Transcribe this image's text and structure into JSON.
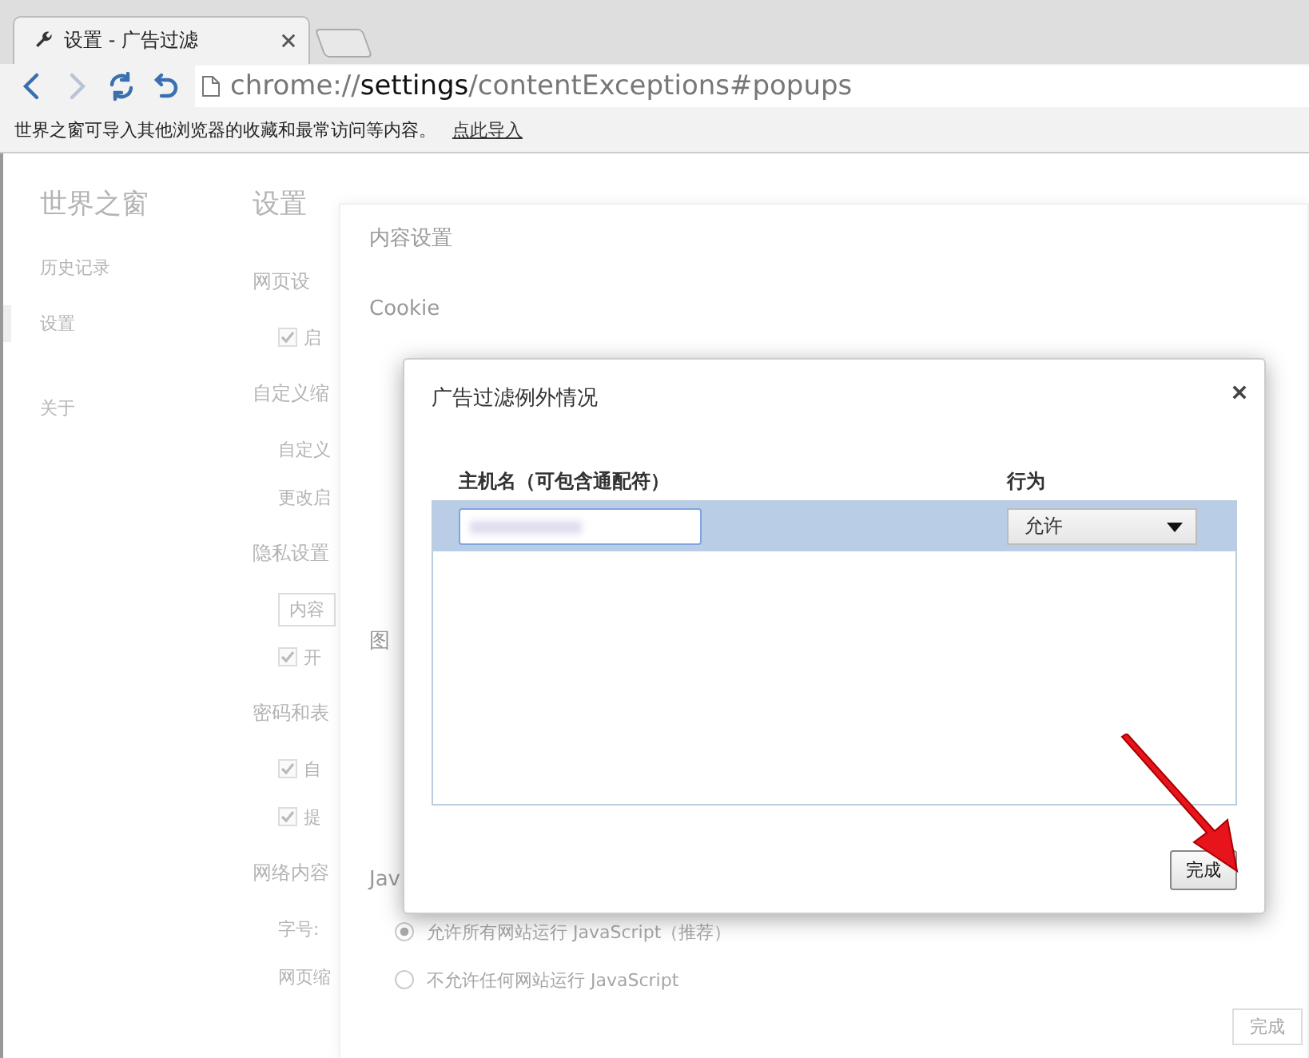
{
  "tabs": [
    {
      "title": "设置 - 广告过滤",
      "selected": true
    }
  ],
  "toolbar": {
    "buttons": [
      {
        "kind": "back",
        "disabled": false
      },
      {
        "kind": "forward",
        "disabled": true
      },
      {
        "kind": "reload",
        "disabled": false
      },
      {
        "kind": "undo",
        "disabled": false
      }
    ]
  },
  "address_bar": {
    "scheme": "chrome://",
    "host": "settings",
    "path": "/contentExceptions#popups"
  },
  "info_bar": {
    "text": "世界之窗可导入其他浏览器的收藏和最常访问等内容。",
    "link": "点此导入"
  },
  "background_page": {
    "sidebar": {
      "title": "世界之窗",
      "items": [
        {
          "label": "历史记录",
          "selected": false
        },
        {
          "label": "设置",
          "selected": true
        },
        {
          "label": "关于",
          "selected": false
        }
      ]
    },
    "settings": {
      "title": "设置",
      "rows": [
        {
          "kind": "heading",
          "text": "网页设"
        },
        {
          "kind": "checkbox",
          "text": "启",
          "checked": true
        },
        {
          "kind": "heading",
          "text": "自定义缩"
        },
        {
          "kind": "text",
          "text": "自定义"
        },
        {
          "kind": "text",
          "text": "更改启"
        },
        {
          "kind": "heading",
          "text": "隐私设置"
        },
        {
          "kind": "button",
          "text": "内容"
        },
        {
          "kind": "checkbox",
          "text": "开",
          "checked": true
        },
        {
          "kind": "heading",
          "text": "密码和表"
        },
        {
          "kind": "checkbox",
          "text": "自",
          "checked": true
        },
        {
          "kind": "checkbox",
          "text": "提",
          "checked": true
        },
        {
          "kind": "heading",
          "text": "网络内容"
        },
        {
          "kind": "text",
          "text": "字号:"
        },
        {
          "kind": "text",
          "text": "网页缩"
        }
      ]
    }
  },
  "content_settings": {
    "title": "内容设置",
    "sections": [
      {
        "heading": "Cookie"
      },
      {
        "heading": "图"
      },
      {
        "heading": "Jav",
        "options": [
          {
            "label": "允许所有网站运行 JavaScript（推荐）",
            "selected": true
          },
          {
            "label": "不允许任何网站运行 JavaScript",
            "selected": false
          }
        ]
      }
    ],
    "done_button": {
      "label": "完成",
      "disabled": true
    }
  },
  "dialog": {
    "title": "广告过滤例外情况",
    "columns": [
      "主机名（可包含通配符）",
      "行为"
    ],
    "rows": [
      {
        "selected": true,
        "behavior": "允许"
      }
    ],
    "done_button": "完成"
  }
}
